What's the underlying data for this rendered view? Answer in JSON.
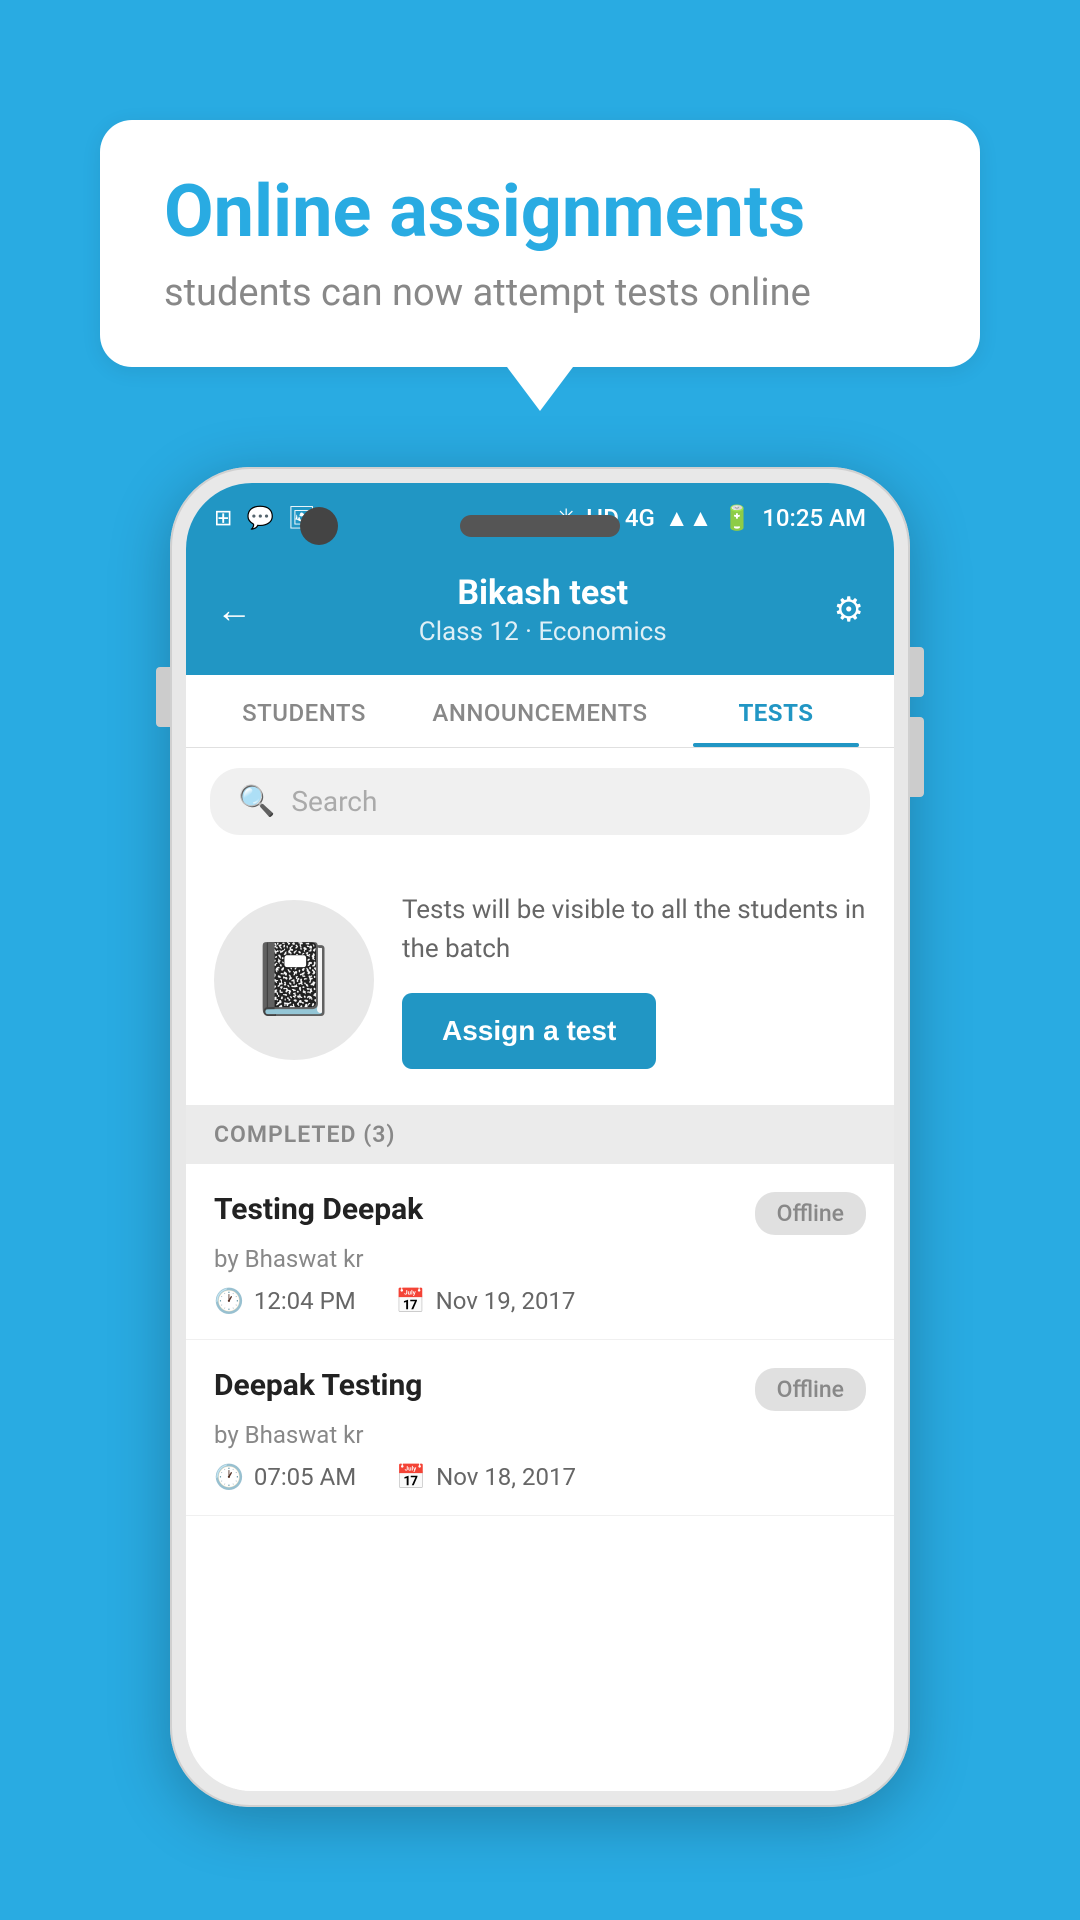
{
  "background_color": "#29ABE2",
  "bubble": {
    "title": "Online assignments",
    "subtitle": "students can now attempt tests online"
  },
  "status_bar": {
    "time": "10:25 AM",
    "network": "HD 4G",
    "icons": [
      "app1",
      "whatsapp",
      "photo"
    ]
  },
  "header": {
    "title": "Bikash test",
    "subtitle": "Class 12 · Economics",
    "back_label": "←",
    "settings_label": "⚙"
  },
  "tabs": [
    {
      "label": "STUDENTS",
      "active": false
    },
    {
      "label": "ANNOUNCEMENTS",
      "active": false
    },
    {
      "label": "TESTS",
      "active": true
    }
  ],
  "search": {
    "placeholder": "Search"
  },
  "assign_section": {
    "description": "Tests will be visible to all the students in the batch",
    "button_label": "Assign a test"
  },
  "completed": {
    "header": "COMPLETED (3)",
    "items": [
      {
        "name": "Testing Deepak",
        "badge": "Offline",
        "by": "by Bhaswat kr",
        "time": "12:04 PM",
        "date": "Nov 19, 2017"
      },
      {
        "name": "Deepak Testing",
        "badge": "Offline",
        "by": "by Bhaswat kr",
        "time": "07:05 AM",
        "date": "Nov 18, 2017"
      }
    ]
  }
}
